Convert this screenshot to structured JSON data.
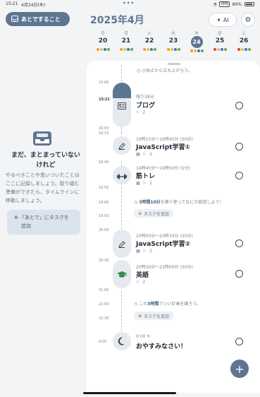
{
  "status": {
    "time": "15:21",
    "date": "4月24日(木)",
    "dots": "•••",
    "vpn": "VPN",
    "battery": "80%"
  },
  "header": {
    "later_label": "あとですること",
    "year_month": "2025年4月",
    "ai_label": "AI"
  },
  "week": [
    {
      "dow": "日",
      "num": "20",
      "dots": [
        "#f0a020",
        "#e0c040",
        "#3b6fd1",
        "#6aaa3a"
      ]
    },
    {
      "dow": "月",
      "num": "21",
      "dots": [
        "#f0a020",
        "#e0c040",
        "#3b6fd1",
        "#6aaa3a"
      ]
    },
    {
      "dow": "火",
      "num": "22",
      "dots": [
        "#f0a020",
        "#e0c040",
        "#3b6fd1",
        "#6aaa3a"
      ]
    },
    {
      "dow": "水",
      "num": "23",
      "dots": [
        "#f0a020",
        "#e0c040",
        "#3b6fd1",
        "#6aaa3a"
      ]
    },
    {
      "dow": "木",
      "num": "24",
      "today": true,
      "dots": [
        "#f0a020",
        "#e0c040",
        "#3b6fd1",
        "#6aaa3a"
      ]
    },
    {
      "dow": "金",
      "num": "25",
      "dots": [
        "#e04040",
        "#e0c040",
        "#3b6fd1",
        "#6aaa3a"
      ]
    },
    {
      "dow": "土",
      "num": "26",
      "dots": [
        "#e04040",
        "#e0c040",
        "#3b6fd1",
        "#6aaa3a"
      ]
    }
  ],
  "left_panel": {
    "title_line1": "まだ、まとまっていない",
    "title_line2": "けれど",
    "desc": "やるべきことや思いついたことはここに記録しましょう。取り組む準備ができたら、タイムラインに移動しましょう。",
    "add_line1": "「あとで」にタスクを",
    "add_line2": "追加"
  },
  "timeline": {
    "top_note": "小休止から立ち上がろう。",
    "labels": {
      "t1500": "15:00",
      "t1521": "15:21",
      "t1600": "16:00",
      "t1615": "16:15",
      "t1645": "16:45",
      "t1650": "16:50",
      "t1900": "19:00",
      "t1950": "19:50",
      "t2000": "20:00",
      "t2030": "20:30",
      "t2100": "21:00",
      "t2200": "22:00",
      "t2230": "22:30",
      "t0000": "0:00"
    },
    "tasks": [
      {
        "time": "残り38分",
        "title": "ブログ",
        "meta": "2"
      },
      {
        "time": "16時15分〜16時45分 (30分)",
        "title": "JavaScript学習①",
        "meta": "2"
      },
      {
        "time": "16時45分〜16時50分 (5分)",
        "title": "筋トレ",
        "meta": "1"
      },
      {
        "time": "20時00分〜20時30分 (30分)",
        "title": "JavaScript学習②",
        "meta": "2"
      },
      {
        "time": "20時30分〜21時00分 (30分)",
        "title": "英語",
        "meta": "2"
      },
      {
        "time": "0:00",
        "title": "おやすみなさい！"
      }
    ],
    "gap1_prefix": "3時間10分",
    "gap1_suffix": "を稼ぐ使ってなにか創造しよう！",
    "gap2_prefix": "この",
    "gap2_hi": "3時間",
    "gap2_suffix": "でいい計画を練ろう。",
    "add_task_label": "タスクを追加"
  }
}
